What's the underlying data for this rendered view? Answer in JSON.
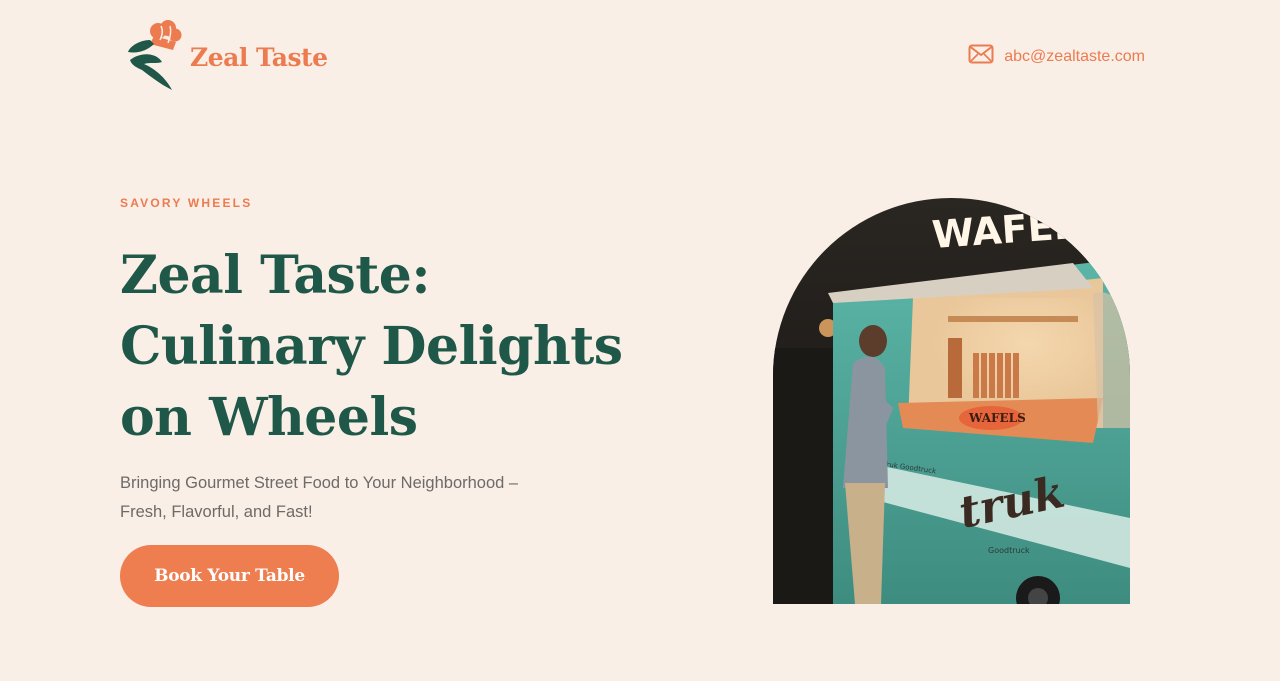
{
  "header": {
    "brand_name": "Zeal Taste",
    "contact_email": "abc@zealtaste.com"
  },
  "hero": {
    "eyebrow": "SAVORY WHEELS",
    "headline_lines": [
      "Zeal Taste:",
      "Culinary Delights",
      "on Wheels"
    ],
    "subtitle_lines": [
      "Bringing Gourmet Street Food to Your Neighborhood –",
      "Fresh, Flavorful, and Fast!"
    ],
    "cta_label": "Book Your Table",
    "image_text": {
      "sign": "WAFELS",
      "counter_sign": "WAFELS",
      "truck_script": "truk",
      "truck_small": "Goodtruck",
      "truck_side": "Truk Goodtruck"
    }
  },
  "colors": {
    "background": "#f9efe7",
    "accent": "#ee7d50",
    "heading": "#1f5848",
    "body_text": "#6e6a67",
    "truck_teal": "#4fa79a"
  },
  "icons": {
    "logo": "chef-hat-leaf-logo-icon",
    "email": "mail-envelope-icon"
  }
}
